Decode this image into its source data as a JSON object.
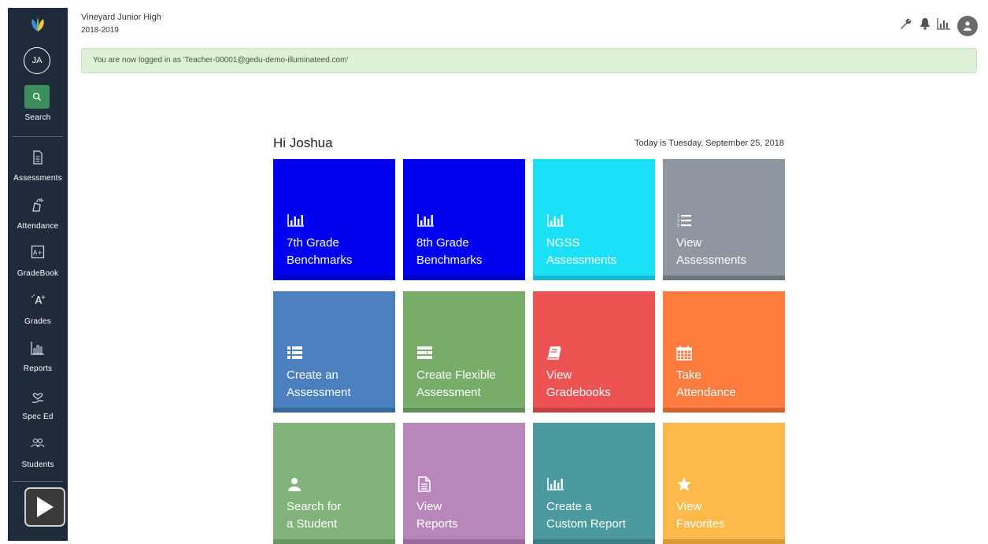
{
  "school": {
    "name": "Vineyard Junior High",
    "year": "2018-2019"
  },
  "user": {
    "initials": "JA"
  },
  "sidebar": {
    "search_label": "Search",
    "items": [
      {
        "label": "Assessments",
        "icon": "document-icon"
      },
      {
        "label": "Attendance",
        "icon": "attendance-icon"
      },
      {
        "label": "GradeBook",
        "icon": "gradebook-icon"
      },
      {
        "label": "Grades",
        "icon": "grades-icon"
      },
      {
        "label": "Reports",
        "icon": "reports-icon"
      },
      {
        "label": "Spec Ed",
        "icon": "spec-ed-icon"
      },
      {
        "label": "Students",
        "icon": "students-icon"
      }
    ]
  },
  "alert": {
    "text": "You are now logged in as 'Teacher-00001@gedu-demo-illuminateed.com'"
  },
  "dashboard": {
    "greeting": "Hi Joshua",
    "today": "Today is Tuesday, September 25, 2018",
    "tiles": [
      {
        "line1": "7th Grade",
        "line2": "Benchmarks",
        "icon": "bar-chart-icon",
        "color": "#0000f0",
        "bar": "#0000c8"
      },
      {
        "line1": "8th Grade",
        "line2": "Benchmarks",
        "icon": "bar-chart-icon",
        "color": "#0000f0",
        "bar": "#0000c8"
      },
      {
        "line1": "NGSS",
        "line2": "Assessments",
        "icon": "bar-chart-icon",
        "color": "#1ce0f5",
        "bar": "#17b9cc"
      },
      {
        "line1": "View",
        "line2": "Assessments",
        "icon": "numbered-list-icon",
        "color": "#8e969f",
        "bar": "#6d747c"
      },
      {
        "line1": "Create an",
        "line2": "Assessment",
        "icon": "list-icon",
        "color": "#4a7fc0",
        "bar": "#3a669c"
      },
      {
        "line1": "Create Flexible",
        "line2": "Assessment",
        "icon": "flexible-list-icon",
        "color": "#77ad68",
        "bar": "#5e8c52"
      },
      {
        "line1": "View",
        "line2": "Gradebooks",
        "icon": "book-icon",
        "color": "#ec5353",
        "bar": "#c63f3f"
      },
      {
        "line1": "Take",
        "line2": "Attendance",
        "icon": "calendar-icon",
        "color": "#fd7c3e",
        "bar": "#d3632e"
      },
      {
        "line1": "Search for",
        "line2": "a Student",
        "icon": "user-icon",
        "color": "#82b37b",
        "bar": "#689461"
      },
      {
        "line1": "View",
        "line2": "Reports",
        "icon": "document-icon",
        "color": "#b886ba",
        "bar": "#986c99"
      },
      {
        "line1": "Create a",
        "line2": "Custom Report",
        "icon": "bar-chart-icon",
        "color": "#4a9a9f",
        "bar": "#3a7d82"
      },
      {
        "line1": "View",
        "line2": "Favorites",
        "icon": "star-icon",
        "color": "#fdb94a",
        "bar": "#d99a36"
      }
    ]
  }
}
